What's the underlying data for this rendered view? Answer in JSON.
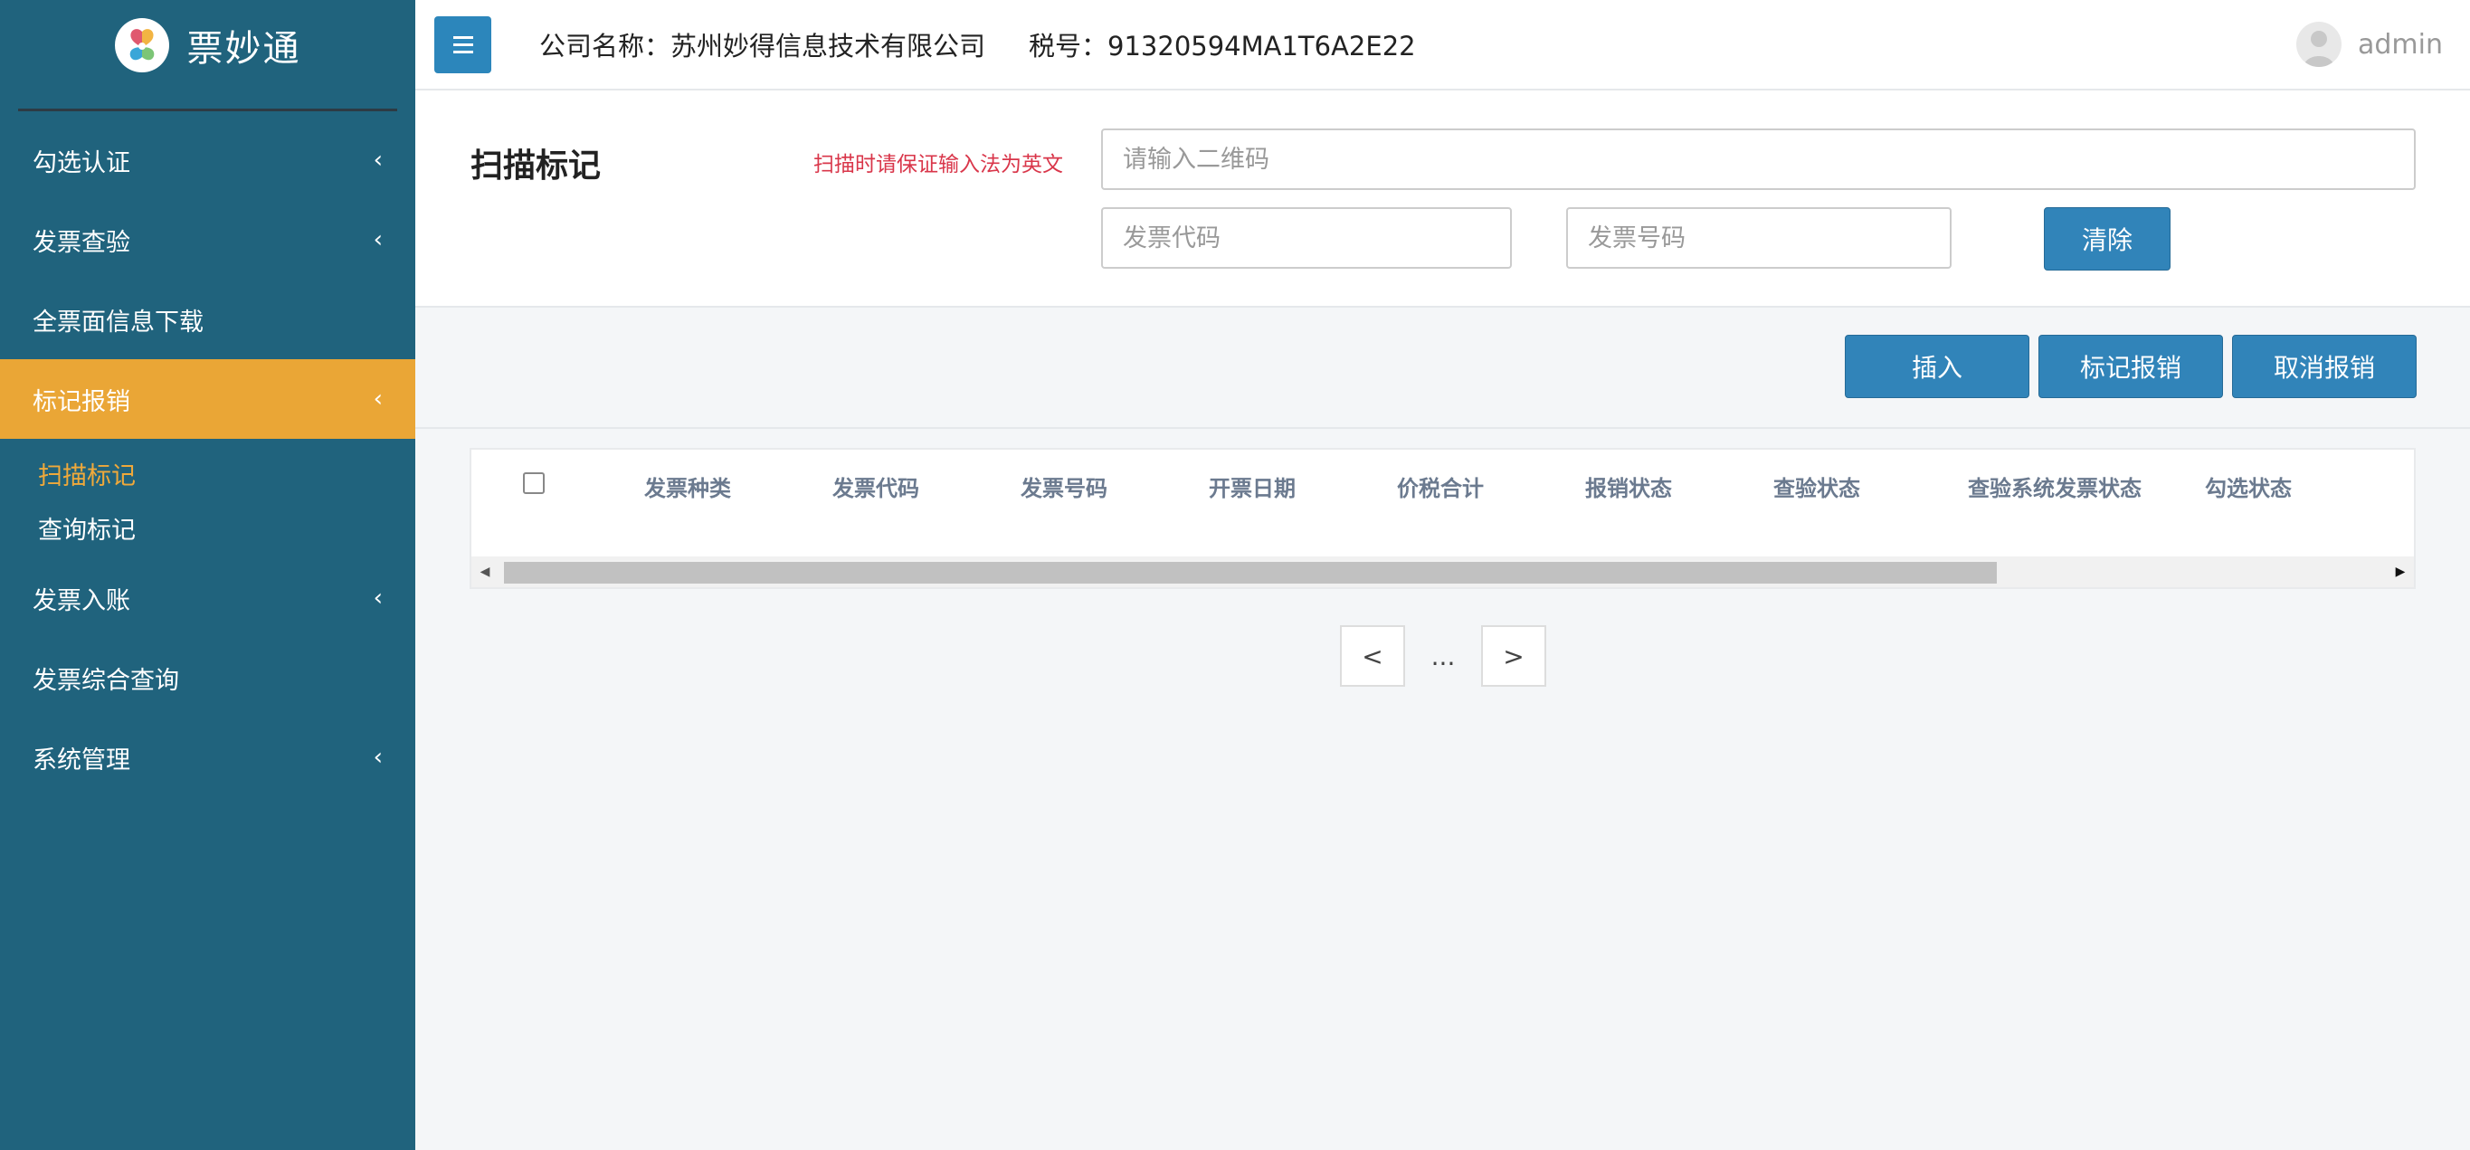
{
  "app": {
    "name": "票妙通"
  },
  "header": {
    "company_label": "公司名称：苏州妙得信息技术有限公司",
    "tax_label": "税号：91320594MA1T6A2E22",
    "username": "admin"
  },
  "sidebar": {
    "items": [
      {
        "label": "勾选认证",
        "has_children": true
      },
      {
        "label": "发票查验",
        "has_children": true
      },
      {
        "label": "全票面信息下载",
        "has_children": false
      },
      {
        "label": "标记报销",
        "has_children": true,
        "active": true
      },
      {
        "label": "发票入账",
        "has_children": true
      },
      {
        "label": "发票综合查询",
        "has_children": false
      },
      {
        "label": "系统管理",
        "has_children": true
      }
    ],
    "sub_items": [
      {
        "label": "扫描标记",
        "active": true
      },
      {
        "label": "查询标记",
        "active": false
      }
    ]
  },
  "scan": {
    "title": "扫描标记",
    "hint": "扫描时请保证输入法为英文",
    "qr_placeholder": "请输入二维码",
    "code_placeholder": "发票代码",
    "number_placeholder": "发票号码",
    "clear_label": "清除"
  },
  "actions": {
    "insert_label": "插入",
    "mark_label": "标记报销",
    "cancel_label": "取消报销"
  },
  "table": {
    "columns": [
      "发票种类",
      "发票代码",
      "发票号码",
      "开票日期",
      "价税合计",
      "报销状态",
      "查验状态",
      "查验系统发票状态",
      "勾选状态"
    ],
    "rows": []
  },
  "pagination": {
    "prev": "<",
    "ellipsis": "...",
    "next": ">"
  },
  "colors": {
    "sidebar_bg": "#20637d",
    "active_menu": "#eaa636",
    "primary_button": "#3184b9",
    "hint_text": "#d9364a"
  }
}
